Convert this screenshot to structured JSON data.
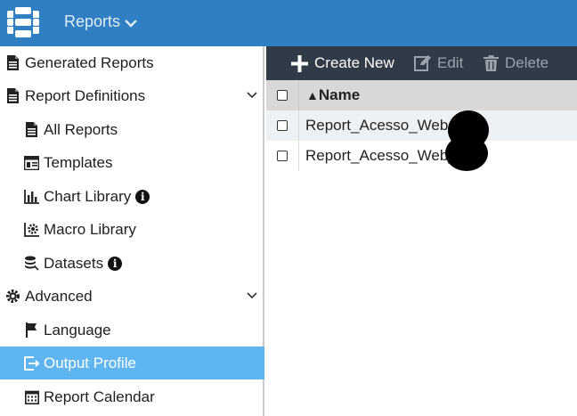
{
  "header": {
    "module_title": "Reports"
  },
  "sidebar": {
    "items": [
      {
        "label": "Generated Reports"
      },
      {
        "label": "Report Definitions"
      },
      {
        "label": "All Reports"
      },
      {
        "label": "Templates"
      },
      {
        "label": "Chart Library"
      },
      {
        "label": "Macro Library"
      },
      {
        "label": "Datasets"
      },
      {
        "label": "Advanced"
      },
      {
        "label": "Language"
      },
      {
        "label": "Output Profile"
      },
      {
        "label": "Report Calendar"
      }
    ]
  },
  "toolbar": {
    "create_new": "Create New",
    "edit": "Edit",
    "delete": "Delete"
  },
  "table": {
    "sort_indicator": "▲",
    "name_header": "Name",
    "rows": [
      {
        "name": "Report_Acesso_Web_"
      },
      {
        "name": "Report_Acesso_Web_"
      }
    ]
  },
  "colors": {
    "topbar": "#2f7fc2",
    "toolbar": "#313b47",
    "active_item": "#5fb5f0"
  }
}
